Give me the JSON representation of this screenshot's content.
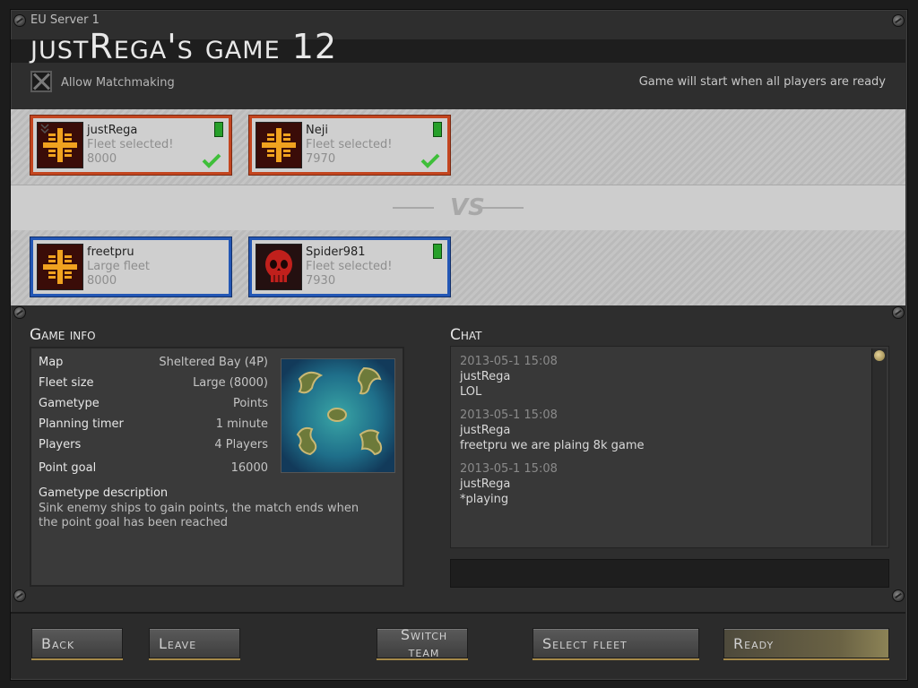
{
  "window": {
    "server": "EU Server 1",
    "title": "justRega's game 12",
    "allow_matchmaking_label": "Allow Matchmaking",
    "start_message": "Game will start when all players are ready"
  },
  "teams": {
    "top": [
      {
        "name": "justRega",
        "status": "Fleet selected!",
        "score": "8000",
        "ready": true,
        "avatar_icon": "fleet-emblem-icon",
        "team_color": "#c3451f"
      },
      {
        "name": "Neji",
        "status": "Fleet selected!",
        "score": "7970",
        "ready": true,
        "avatar_icon": "fleet-emblem-icon",
        "team_color": "#c3451f"
      }
    ],
    "vs_label": "VS",
    "bottom": [
      {
        "name": "freetpru",
        "status": "Large fleet",
        "score": "8000",
        "ready": false,
        "avatar_icon": "fleet-emblem-icon",
        "team_color": "#2357b5"
      },
      {
        "name": "Spider981",
        "status": "Fleet selected!",
        "score": "7930",
        "ready": false,
        "avatar_icon": "red-skull-icon",
        "team_color": "#2357b5"
      }
    ]
  },
  "game_info": {
    "title": "Game info",
    "rows": [
      {
        "key": "Map",
        "value": "Sheltered Bay (4P)"
      },
      {
        "key": "Fleet size",
        "value": "Large (8000)"
      },
      {
        "key": "Gametype",
        "value": "Points"
      },
      {
        "key": "Planning timer",
        "value": "1 minute"
      },
      {
        "key": "Players",
        "value": "4 Players"
      },
      {
        "key": "Point goal",
        "value": "16000"
      }
    ],
    "description_title": "Gametype description",
    "description": "Sink enemy ships to gain points, the match ends when the point goal has been reached"
  },
  "chat": {
    "title": "Chat",
    "messages": [
      {
        "timestamp": "2013-05-1 15:08",
        "author": "justRega",
        "text": "LOL"
      },
      {
        "timestamp": "2013-05-1 15:08",
        "author": "justRega",
        "text": "freetpru we are plaing 8k game"
      },
      {
        "timestamp": "2013-05-1 15:08",
        "author": "justRega",
        "text": "*playing"
      }
    ],
    "input_value": ""
  },
  "buttons": {
    "back": "Back",
    "leave": "Leave",
    "switch_team": "Switch team",
    "select_fleet": "Select fleet",
    "ready": "Ready"
  }
}
